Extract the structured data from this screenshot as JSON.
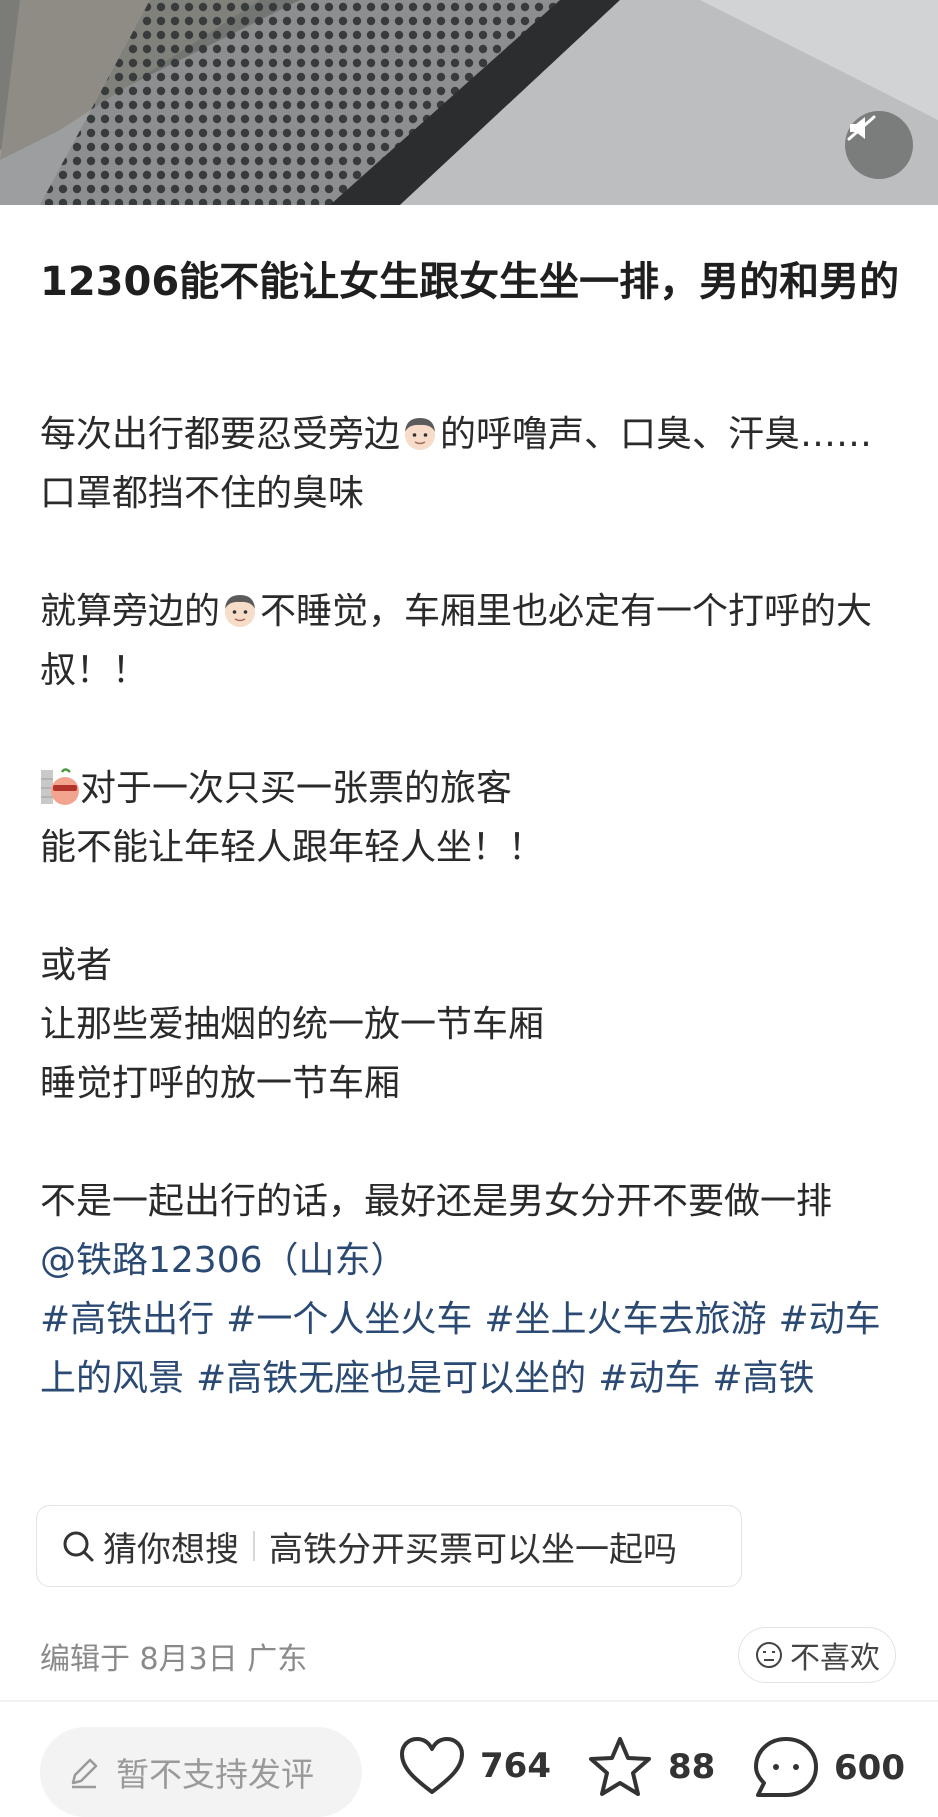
{
  "post": {
    "title": "12306能不能让女生跟女生坐一排，男的和男的",
    "paragraphs": {
      "p1_a": "每次出行都要忍受旁边",
      "p1_b": "的呼噜声、口臭、汗臭……口罩都挡不住的臭味",
      "p2_a": "就算旁边的",
      "p2_b": "不睡觉，车厢里也必定有一个打呼的大叔！！",
      "p3_a": "对于一次只买一张票的旅客",
      "p3_b": "能不能让年轻人跟年轻人坐！！",
      "p4_a": "或者",
      "p4_b": "让那些爱抽烟的统一放一节车厢",
      "p4_c": "睡觉打呼的放一节车厢",
      "p5": "不是一起出行的话，最好还是男女分开不要做一排"
    },
    "mention": "@铁路12306（山东）",
    "tags": [
      "#高铁出行",
      "#一个人坐火车",
      "#坐上火车去旅游",
      "#动车上的风景",
      "#高铁无座也是可以坐的",
      "#动车",
      "#高铁"
    ]
  },
  "search_suggest": {
    "label": "猜你想搜",
    "query": "高铁分开买票可以坐一起吗"
  },
  "meta": {
    "edited": "编辑于 8月3日 广东",
    "dislike_label": "不喜欢"
  },
  "bottom_bar": {
    "comment_placeholder": "暂不支持发评",
    "likes": "764",
    "favorites": "88",
    "comments": "600"
  },
  "icons": {
    "mute": "speaker-mute-icon",
    "search": "search-icon",
    "dislike": "frown-face-icon",
    "edit": "pencil-icon",
    "like": "heart-icon",
    "favorite": "star-icon",
    "comment": "chat-bubble-icon",
    "man_emoji": "man-face-emoji",
    "sly_emoji": "peeking-emoji"
  },
  "colors": {
    "link": "#2b4a73",
    "meta": "#8a8a8a"
  }
}
